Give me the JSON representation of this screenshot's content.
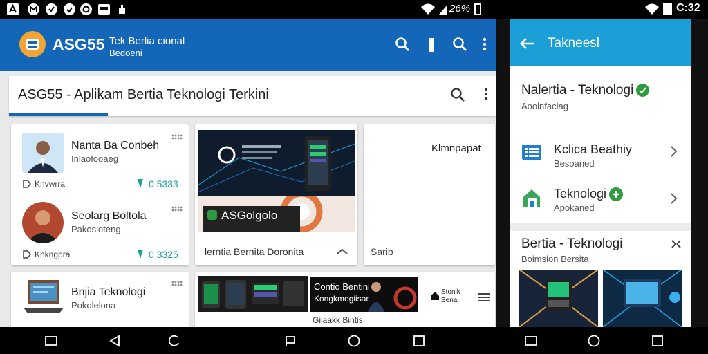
{
  "status_bar": {
    "left_battery": "26%",
    "right_time": "C:32"
  },
  "main_app": {
    "logo_title": "ASG55",
    "subtitle_line1": "Tek Berlia cional",
    "subtitle_line2": "Bedoeni",
    "search_bar_text": "ASG55 - Aplikam Bertia Teknologi Terkini",
    "people_card": {
      "items": [
        {
          "name": "Nanta Ba Conbeh",
          "subtitle": "Inlaofooaeg",
          "left_meta": "Knvwrra",
          "count": "0 5333"
        },
        {
          "name": "Seolarg Boltola",
          "subtitle": "Pakosioteng",
          "left_meta": "Knkngpra",
          "count": "0 3325"
        }
      ]
    },
    "featured_card": {
      "banner_text1": "ASGolgolo",
      "logo_text": "ASGolgolo",
      "caption": "lerntia Bernita Doronita"
    },
    "right_card": {
      "title": "Klmnpapat",
      "footer": "Sarib"
    },
    "bottom_left_card": {
      "title": "Bnjia Teknologi",
      "subtitle": "Pokolelona"
    },
    "bottom_news": {
      "headline": "Contio Bentini",
      "subtitle": "Kongkmogiisan",
      "footer": "Gilaakk Bintis",
      "side_text1": "Stonik",
      "side_text2": "Bena"
    }
  },
  "side_app": {
    "title": "Takneesl",
    "header_title": "Nalertia - Teknologi",
    "header_subtitle": "Aoolnfaclag",
    "list_items": [
      {
        "title": "Kclica Beathiy",
        "subtitle": "Besoaned"
      },
      {
        "title": "Teknologi",
        "subtitle": "Apokaned"
      }
    ],
    "section_title": "Bertia - Teknologi",
    "section_subtitle": "Boimsion Bersita"
  },
  "colors": {
    "primary": "#1466b8",
    "side_primary": "#1c9fd7",
    "accent_teal": "#16a39b",
    "accent_green": "#2e9b3e"
  }
}
